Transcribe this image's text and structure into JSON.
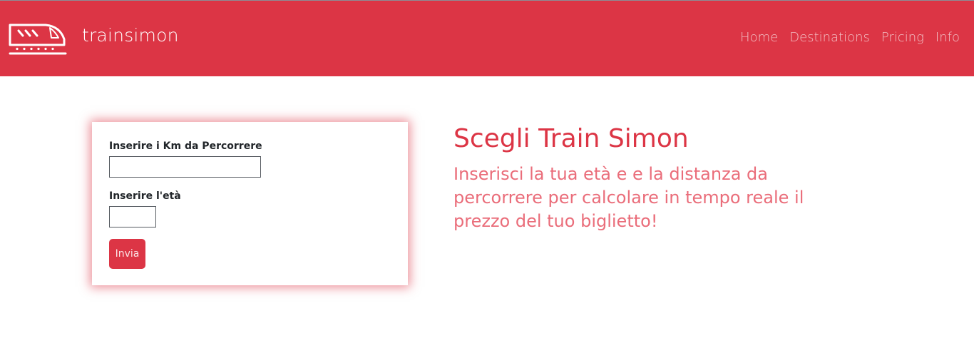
{
  "brand": {
    "name": "trainsimon",
    "logo_icon": "train-icon"
  },
  "nav": {
    "items": [
      {
        "label": "Home"
      },
      {
        "label": "Destinations"
      },
      {
        "label": "Pricing"
      },
      {
        "label": "Info"
      }
    ]
  },
  "form": {
    "km_label": "Inserire i Km da Percorrere",
    "km_value": "",
    "age_label": "Inserire l'età",
    "age_value": "",
    "submit_label": "Invia"
  },
  "hero": {
    "title": "Scegli Train Simon",
    "subtitle": "Inserisci la tua età e e la distanza da percorrere per calcolare in tempo reale il prezzo del tuo biglietto!"
  },
  "colors": {
    "accent": "#dc3545",
    "subtitle": "#ea6d7a",
    "nav_link": "#f2c0c5"
  }
}
